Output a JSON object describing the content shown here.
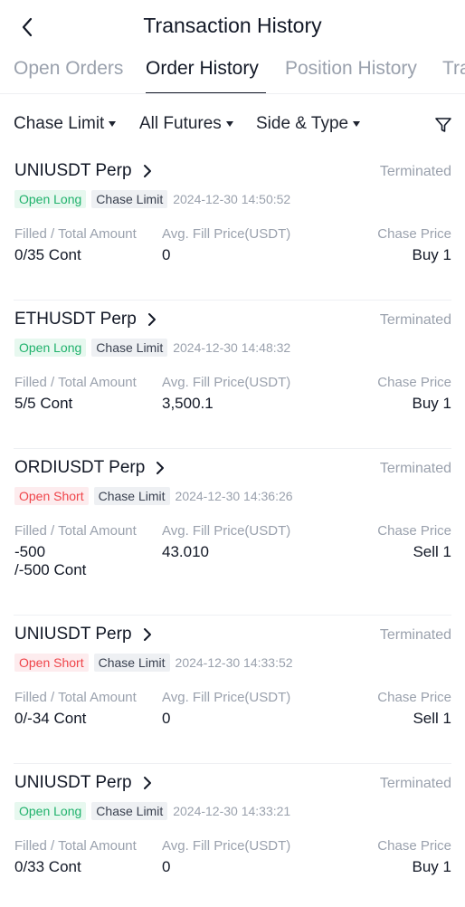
{
  "header": {
    "title": "Transaction History"
  },
  "tabs": [
    {
      "label": "Open Orders"
    },
    {
      "label": "Order History"
    },
    {
      "label": "Position History"
    },
    {
      "label": "Tra"
    }
  ],
  "filters": [
    {
      "label": "Chase Limit"
    },
    {
      "label": "All Futures"
    },
    {
      "label": "Side & Type"
    }
  ],
  "columns": {
    "filled": "Filled / Total Amount",
    "avg": "Avg. Fill Price(USDT)",
    "chase": "Chase Price"
  },
  "orders": [
    {
      "symbol": "UNIUSDT Perp",
      "status": "Terminated",
      "side": "Open Long",
      "side_kind": "long",
      "type": "Chase Limit",
      "time": "2024-12-30 14:50:52",
      "filled": "0/35 Cont",
      "avg": "0",
      "chase": "Buy 1"
    },
    {
      "symbol": "ETHUSDT Perp",
      "status": "Terminated",
      "side": "Open Long",
      "side_kind": "long",
      "type": "Chase Limit",
      "time": "2024-12-30 14:48:32",
      "filled": "5/5 Cont",
      "avg": "3,500.1",
      "chase": "Buy 1"
    },
    {
      "symbol": "ORDIUSDT Perp",
      "status": "Terminated",
      "side": "Open Short",
      "side_kind": "short",
      "type": "Chase Limit",
      "time": "2024-12-30 14:36:26",
      "filled": "-500\n/-500 Cont",
      "avg": "43.010",
      "chase": "Sell 1"
    },
    {
      "symbol": "UNIUSDT Perp",
      "status": "Terminated",
      "side": "Open Short",
      "side_kind": "short",
      "type": "Chase Limit",
      "time": "2024-12-30 14:33:52",
      "filled": "0/-34 Cont",
      "avg": "0",
      "chase": "Sell 1"
    },
    {
      "symbol": "UNIUSDT Perp",
      "status": "Terminated",
      "side": "Open Long",
      "side_kind": "long",
      "type": "Chase Limit",
      "time": "2024-12-30 14:33:21",
      "filled": "0/33 Cont",
      "avg": "0",
      "chase": "Buy 1"
    }
  ]
}
